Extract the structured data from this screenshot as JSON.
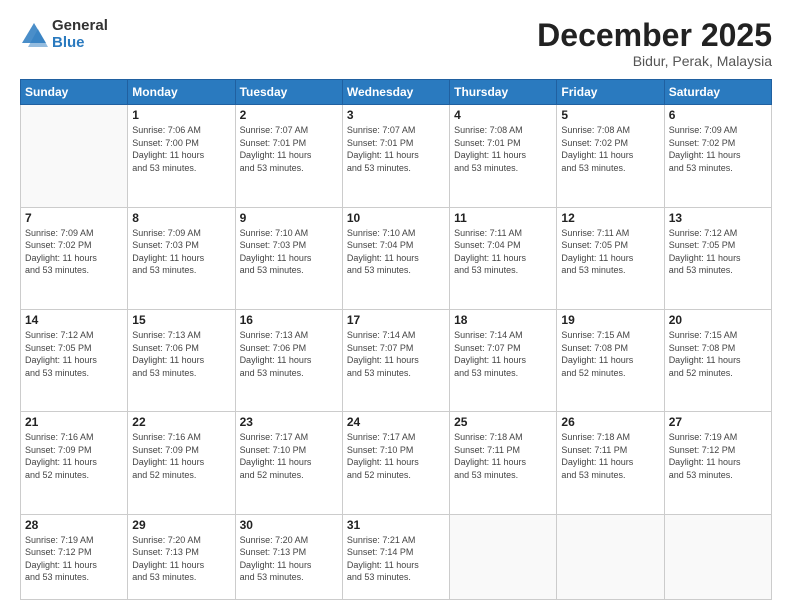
{
  "header": {
    "logo_general": "General",
    "logo_blue": "Blue",
    "month_title": "December 2025",
    "location": "Bidur, Perak, Malaysia"
  },
  "days_of_week": [
    "Sunday",
    "Monday",
    "Tuesday",
    "Wednesday",
    "Thursday",
    "Friday",
    "Saturday"
  ],
  "weeks": [
    [
      {
        "day": "",
        "info": ""
      },
      {
        "day": "1",
        "info": "Sunrise: 7:06 AM\nSunset: 7:00 PM\nDaylight: 11 hours\nand 53 minutes."
      },
      {
        "day": "2",
        "info": "Sunrise: 7:07 AM\nSunset: 7:01 PM\nDaylight: 11 hours\nand 53 minutes."
      },
      {
        "day": "3",
        "info": "Sunrise: 7:07 AM\nSunset: 7:01 PM\nDaylight: 11 hours\nand 53 minutes."
      },
      {
        "day": "4",
        "info": "Sunrise: 7:08 AM\nSunset: 7:01 PM\nDaylight: 11 hours\nand 53 minutes."
      },
      {
        "day": "5",
        "info": "Sunrise: 7:08 AM\nSunset: 7:02 PM\nDaylight: 11 hours\nand 53 minutes."
      },
      {
        "day": "6",
        "info": "Sunrise: 7:09 AM\nSunset: 7:02 PM\nDaylight: 11 hours\nand 53 minutes."
      }
    ],
    [
      {
        "day": "7",
        "info": "Sunrise: 7:09 AM\nSunset: 7:02 PM\nDaylight: 11 hours\nand 53 minutes."
      },
      {
        "day": "8",
        "info": "Sunrise: 7:09 AM\nSunset: 7:03 PM\nDaylight: 11 hours\nand 53 minutes."
      },
      {
        "day": "9",
        "info": "Sunrise: 7:10 AM\nSunset: 7:03 PM\nDaylight: 11 hours\nand 53 minutes."
      },
      {
        "day": "10",
        "info": "Sunrise: 7:10 AM\nSunset: 7:04 PM\nDaylight: 11 hours\nand 53 minutes."
      },
      {
        "day": "11",
        "info": "Sunrise: 7:11 AM\nSunset: 7:04 PM\nDaylight: 11 hours\nand 53 minutes."
      },
      {
        "day": "12",
        "info": "Sunrise: 7:11 AM\nSunset: 7:05 PM\nDaylight: 11 hours\nand 53 minutes."
      },
      {
        "day": "13",
        "info": "Sunrise: 7:12 AM\nSunset: 7:05 PM\nDaylight: 11 hours\nand 53 minutes."
      }
    ],
    [
      {
        "day": "14",
        "info": "Sunrise: 7:12 AM\nSunset: 7:05 PM\nDaylight: 11 hours\nand 53 minutes."
      },
      {
        "day": "15",
        "info": "Sunrise: 7:13 AM\nSunset: 7:06 PM\nDaylight: 11 hours\nand 53 minutes."
      },
      {
        "day": "16",
        "info": "Sunrise: 7:13 AM\nSunset: 7:06 PM\nDaylight: 11 hours\nand 53 minutes."
      },
      {
        "day": "17",
        "info": "Sunrise: 7:14 AM\nSunset: 7:07 PM\nDaylight: 11 hours\nand 53 minutes."
      },
      {
        "day": "18",
        "info": "Sunrise: 7:14 AM\nSunset: 7:07 PM\nDaylight: 11 hours\nand 53 minutes."
      },
      {
        "day": "19",
        "info": "Sunrise: 7:15 AM\nSunset: 7:08 PM\nDaylight: 11 hours\nand 52 minutes."
      },
      {
        "day": "20",
        "info": "Sunrise: 7:15 AM\nSunset: 7:08 PM\nDaylight: 11 hours\nand 52 minutes."
      }
    ],
    [
      {
        "day": "21",
        "info": "Sunrise: 7:16 AM\nSunset: 7:09 PM\nDaylight: 11 hours\nand 52 minutes."
      },
      {
        "day": "22",
        "info": "Sunrise: 7:16 AM\nSunset: 7:09 PM\nDaylight: 11 hours\nand 52 minutes."
      },
      {
        "day": "23",
        "info": "Sunrise: 7:17 AM\nSunset: 7:10 PM\nDaylight: 11 hours\nand 52 minutes."
      },
      {
        "day": "24",
        "info": "Sunrise: 7:17 AM\nSunset: 7:10 PM\nDaylight: 11 hours\nand 52 minutes."
      },
      {
        "day": "25",
        "info": "Sunrise: 7:18 AM\nSunset: 7:11 PM\nDaylight: 11 hours\nand 53 minutes."
      },
      {
        "day": "26",
        "info": "Sunrise: 7:18 AM\nSunset: 7:11 PM\nDaylight: 11 hours\nand 53 minutes."
      },
      {
        "day": "27",
        "info": "Sunrise: 7:19 AM\nSunset: 7:12 PM\nDaylight: 11 hours\nand 53 minutes."
      }
    ],
    [
      {
        "day": "28",
        "info": "Sunrise: 7:19 AM\nSunset: 7:12 PM\nDaylight: 11 hours\nand 53 minutes."
      },
      {
        "day": "29",
        "info": "Sunrise: 7:20 AM\nSunset: 7:13 PM\nDaylight: 11 hours\nand 53 minutes."
      },
      {
        "day": "30",
        "info": "Sunrise: 7:20 AM\nSunset: 7:13 PM\nDaylight: 11 hours\nand 53 minutes."
      },
      {
        "day": "31",
        "info": "Sunrise: 7:21 AM\nSunset: 7:14 PM\nDaylight: 11 hours\nand 53 minutes."
      },
      {
        "day": "",
        "info": ""
      },
      {
        "day": "",
        "info": ""
      },
      {
        "day": "",
        "info": ""
      }
    ]
  ]
}
